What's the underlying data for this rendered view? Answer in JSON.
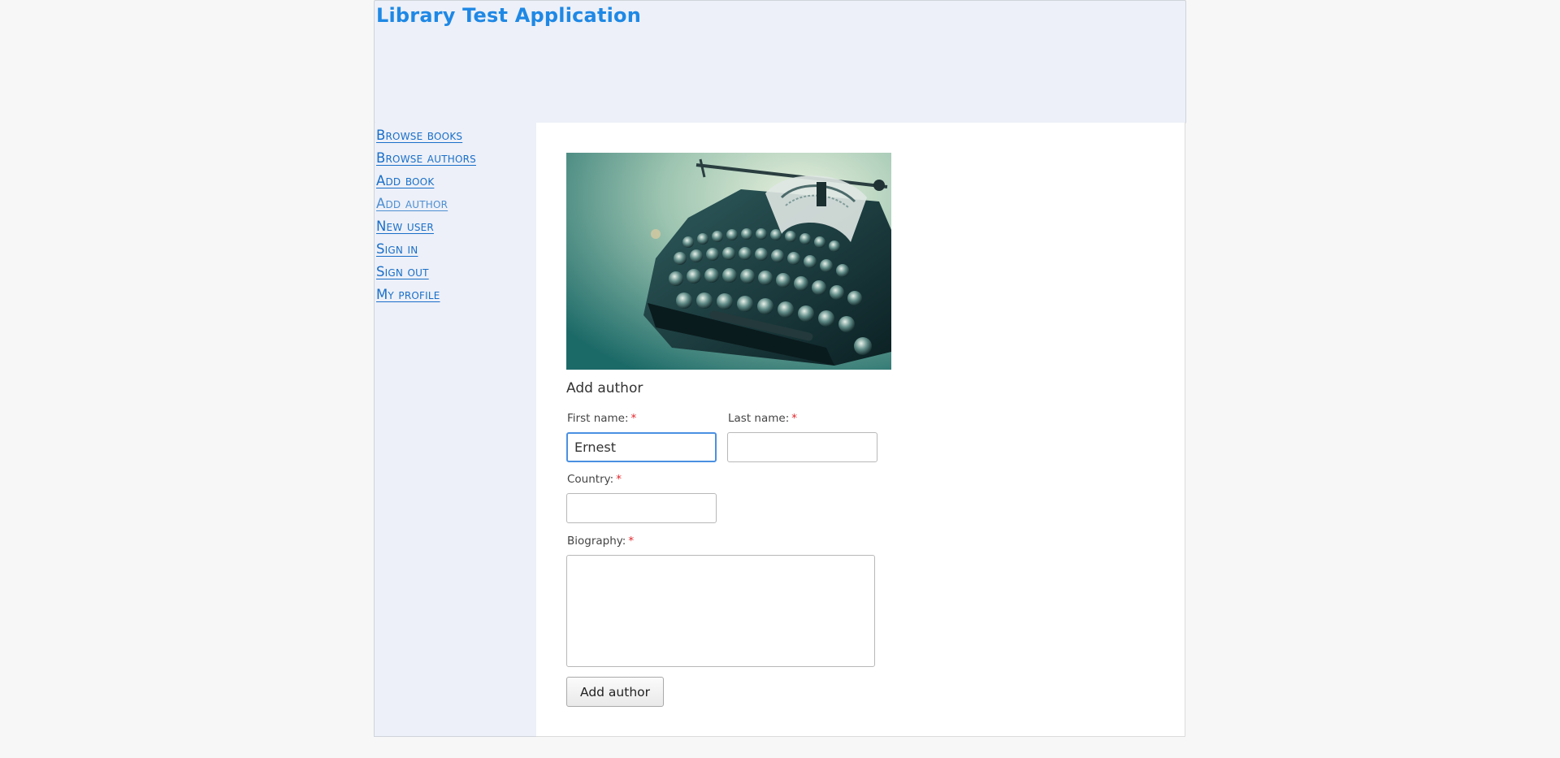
{
  "header": {
    "site_title": "Library Test Application"
  },
  "nav": {
    "items": [
      {
        "label": "Browse books"
      },
      {
        "label": "Browse authors"
      },
      {
        "label": "Add book"
      },
      {
        "label": "Add author",
        "current": true
      },
      {
        "label": "New user"
      },
      {
        "label": "Sign in"
      },
      {
        "label": "Sign out"
      },
      {
        "label": "My profile"
      }
    ]
  },
  "hero_image": {
    "icon": "typewriter-photo"
  },
  "form": {
    "title": "Add author",
    "required_marker": "*",
    "first_name": {
      "label": "First name:",
      "value": "Ernest"
    },
    "last_name": {
      "label": "Last name:",
      "value": ""
    },
    "country": {
      "label": "Country:",
      "value": ""
    },
    "biography": {
      "label": "Biography:",
      "value": ""
    },
    "submit_label": "Add author"
  },
  "colors": {
    "link": "#1a6fc9",
    "title": "#1e88e5",
    "required": "#e4262b",
    "focus": "#4a90e2",
    "panel_bg": "#edf0f8"
  }
}
